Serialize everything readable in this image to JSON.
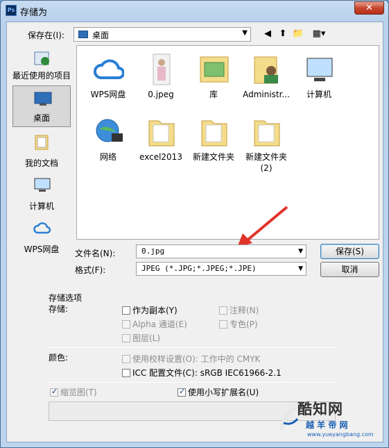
{
  "window": {
    "title": "存储为",
    "app_icon": "Ps",
    "close_glyph": "✕"
  },
  "save_in": {
    "label": "保存在(I):",
    "value": "桌面"
  },
  "toolbar": {
    "back": "◀",
    "up": "⬆",
    "new_folder": "📁",
    "view": "▦▾"
  },
  "places": [
    {
      "label": "最近使用的项目",
      "icon": "recent-icon"
    },
    {
      "label": "桌面",
      "icon": "desktop-icon",
      "active": true
    },
    {
      "label": "我的文档",
      "icon": "documents-icon"
    },
    {
      "label": "计算机",
      "icon": "computer-icon"
    },
    {
      "label": "WPS网盘",
      "icon": "cloud-icon"
    }
  ],
  "files": [
    {
      "name": "WPS网盘",
      "icon": "cloud-icon"
    },
    {
      "name": "0.jpeg",
      "icon": "image-icon"
    },
    {
      "name": "库",
      "icon": "library-icon"
    },
    {
      "name": "Administr...",
      "icon": "user-folder-icon"
    },
    {
      "name": "计算机",
      "icon": "computer-icon"
    },
    {
      "name": "网络",
      "icon": "network-icon"
    },
    {
      "name": "excel2013",
      "icon": "folder-icon"
    },
    {
      "name": "新建文件夹",
      "icon": "folder-icon"
    },
    {
      "name": "新建文件夹\n(2)",
      "icon": "folder-icon"
    }
  ],
  "file_name": {
    "label": "文件名(N):",
    "value": "0.jpg"
  },
  "format": {
    "label": "格式(F):",
    "value": "JPEG (*.JPG;*.JPEG;*.JPE)"
  },
  "buttons": {
    "save": "保存(S)",
    "cancel": "取消"
  },
  "options": {
    "header": "存储选项",
    "storage_label": "存储:",
    "as_copy": "作为副本(Y)",
    "annotations": "注释(N)",
    "alpha": "Alpha 通道(E)",
    "spot": "专色(P)",
    "layers": "图层(L)",
    "color_label": "颜色:",
    "proof": "使用校样设置(O):  工作中的 CMYK",
    "icc": "ICC 配置文件(C):  sRGB IEC61966-2.1",
    "thumbnail": "缩览图(T)",
    "lowercase_ext": "使用小写扩展名(U)"
  },
  "watermark": {
    "brand": "酷知网",
    "sub": "越 羊 帝 网",
    "url": "www.yueyangbang.com"
  },
  "colors": {
    "title_bg": "#bcd4ee",
    "close_red": "#c7472e",
    "arrow_red": "#e0332a"
  }
}
